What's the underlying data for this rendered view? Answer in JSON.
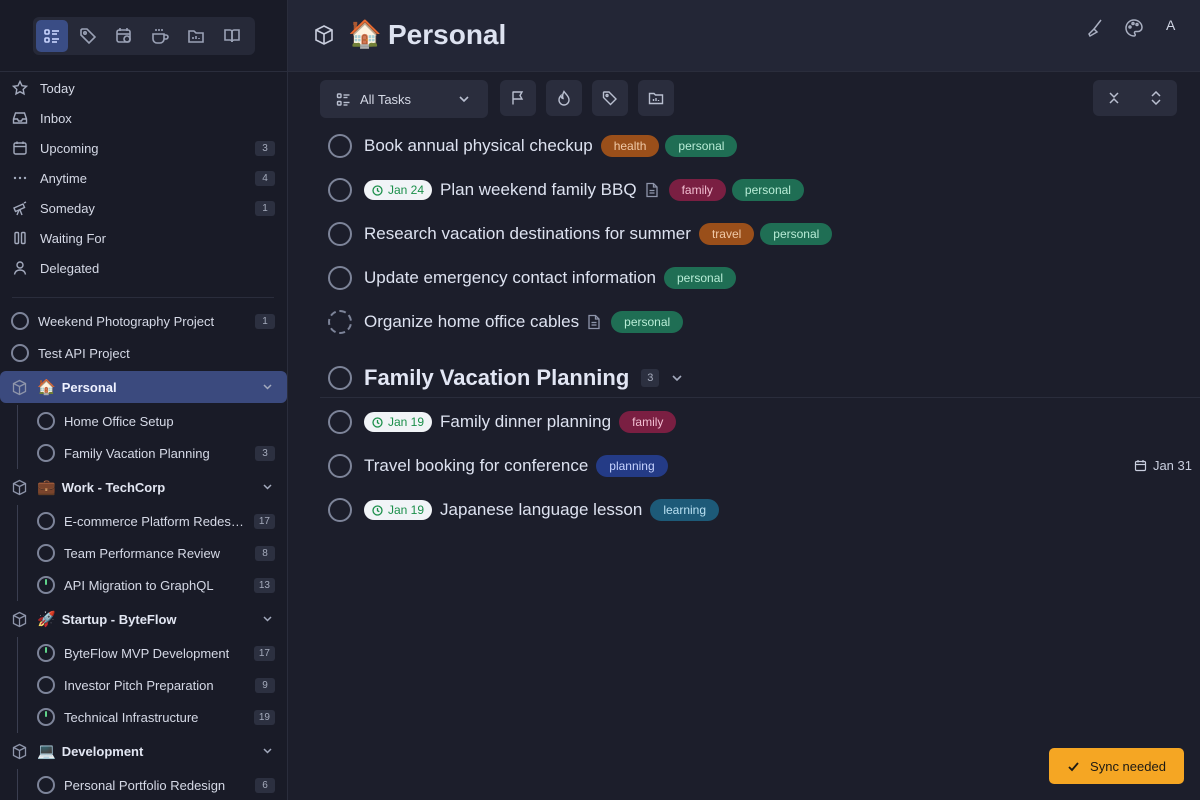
{
  "sidebar": {
    "nav": [
      {
        "label": "Today",
        "icon": "star-icon",
        "count": ""
      },
      {
        "label": "Inbox",
        "icon": "inbox-icon",
        "count": ""
      },
      {
        "label": "Upcoming",
        "icon": "calendar-icon",
        "count": "3"
      },
      {
        "label": "Anytime",
        "icon": "ellipsis-icon",
        "count": "4"
      },
      {
        "label": "Someday",
        "icon": "telescope-icon",
        "count": "1"
      },
      {
        "label": "Waiting For",
        "icon": "pause-icon",
        "count": ""
      },
      {
        "label": "Delegated",
        "icon": "user-icon",
        "count": ""
      }
    ],
    "projects": [
      {
        "label": "Weekend Photography Project",
        "count": "1"
      },
      {
        "label": "Test API Project",
        "count": ""
      }
    ],
    "areas": {
      "personal": {
        "emoji": "🏠",
        "label": "Personal",
        "children": [
          {
            "label": "Home Office Setup",
            "count": ""
          },
          {
            "label": "Family Vacation Planning",
            "count": "3"
          }
        ]
      },
      "work": {
        "emoji": "💼",
        "label": "Work - TechCorp",
        "children": [
          {
            "label": "E-commerce Platform Redesign",
            "count": "17"
          },
          {
            "label": "Team Performance Review",
            "count": "8"
          },
          {
            "label": "API Migration to GraphQL",
            "count": "13"
          }
        ]
      },
      "startup": {
        "emoji": "🚀",
        "label": "Startup - ByteFlow",
        "children": [
          {
            "label": "ByteFlow MVP Development",
            "count": "17"
          },
          {
            "label": "Investor Pitch Preparation",
            "count": "9"
          },
          {
            "label": "Technical Infrastructure",
            "count": "19"
          }
        ]
      },
      "development": {
        "emoji": "💻",
        "label": "Development",
        "children": [
          {
            "label": "Personal Portfolio Redesign",
            "count": "6"
          }
        ]
      }
    }
  },
  "header": {
    "emoji": "🏠",
    "title": "Personal",
    "avatar": "A"
  },
  "toolbar": {
    "view_label": "All Tasks"
  },
  "tasks": [
    {
      "name": "Book annual physical checkup",
      "date": "",
      "tags": [
        "health",
        "personal"
      ]
    },
    {
      "name": "Plan weekend family BBQ",
      "date": "Jan 24",
      "tags": [
        "family",
        "personal"
      ]
    },
    {
      "name": "Research vacation destinations for summer",
      "date": "",
      "tags": [
        "travel",
        "personal"
      ]
    },
    {
      "name": "Update emergency contact information",
      "date": "",
      "tags": [
        "personal"
      ]
    },
    {
      "name": "Organize home office cables",
      "date": "",
      "tags": [
        "personal"
      ]
    }
  ],
  "section": {
    "title": "Family Vacation Planning",
    "count": "3",
    "tasks": [
      {
        "name": "Family dinner planning",
        "date": "Jan 19",
        "tags": [
          "family"
        ],
        "due": ""
      },
      {
        "name": "Travel booking for conference",
        "date": "",
        "tags": [
          "planning"
        ],
        "due": "Jan 31"
      },
      {
        "name": "Japanese language lesson",
        "date": "Jan 19",
        "tags": [
          "learning"
        ],
        "due": ""
      }
    ]
  },
  "toast": {
    "label": "Sync needed"
  }
}
